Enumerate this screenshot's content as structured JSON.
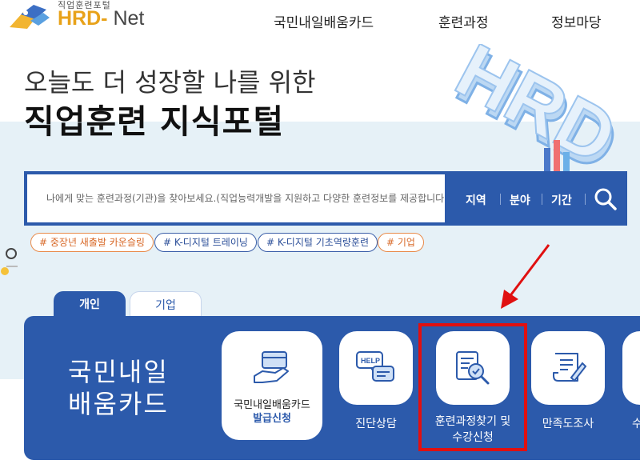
{
  "header": {
    "logo_sub": "직업훈련포털",
    "logo_main_a": "HRD",
    "logo_main_b": "- ",
    "logo_main_c": "Net",
    "nav": [
      "국민내일배움카드",
      "훈련과정",
      "정보마당"
    ]
  },
  "hero": {
    "line1": "오늘도 더 성장할 나를 위한",
    "line2": "직업훈련 지식포털",
    "art_text": "HRD"
  },
  "search": {
    "placeholder": "나에게 맞는 훈련과정(기관)을 찾아보세요.(직업능력개발을 지원하고 다양한 훈련정보를 제공합니다.)",
    "filters": [
      "지역",
      "분야",
      "기간"
    ],
    "button_icon": "search-icon"
  },
  "tags": [
    "# 중장년 새출발 카운슬링",
    "# K-디지털 트레이닝",
    "# K-디지털 기초역량훈련",
    "# 기업"
  ],
  "tabs": [
    "개인",
    "기업"
  ],
  "panel": {
    "title_line1": "국민내일",
    "title_line2": "배움카드",
    "cards": [
      {
        "label_line1": "국민내일배움카드",
        "label_line2": "발급신청",
        "icon": "card-hand-icon"
      },
      {
        "label": "진단상담",
        "icon": "help-chat-icon"
      },
      {
        "label_line1": "훈련과정찾기 및",
        "label_line2": "수강신청",
        "icon": "document-search-icon"
      },
      {
        "label": "만족도조사",
        "icon": "scroll-pen-icon"
      },
      {
        "label": "수",
        "icon": "more-icon"
      }
    ]
  },
  "colors": {
    "brand_blue": "#2c5aab",
    "logo_orange": "#e8a21a",
    "highlight_red": "#e01010",
    "hero_band": "#e6f1f7"
  }
}
